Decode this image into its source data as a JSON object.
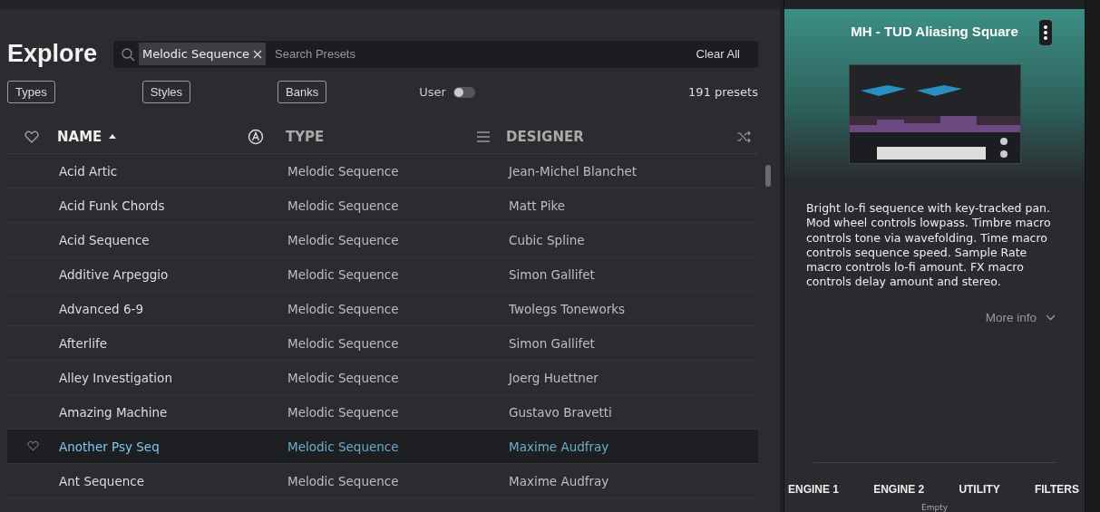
{
  "explore": {
    "title": "Explore",
    "search": {
      "chip": "Melodic Sequence",
      "placeholder": "Search Presets",
      "clear": "Clear All"
    },
    "filters": [
      "Types",
      "Styles",
      "Banks"
    ],
    "user_toggle": {
      "label": "User",
      "on": false
    },
    "count": "191 presets"
  },
  "table": {
    "columns": [
      {
        "kind": "name",
        "label": "NAME",
        "sorted": true
      },
      {
        "kind": "type",
        "label": "TYPE",
        "sorted": false
      },
      {
        "kind": "designer",
        "label": "DESIGNER",
        "sorted": false
      }
    ],
    "rows": [
      {
        "name": "Acid Artic",
        "type": "Melodic Sequence",
        "designer": "Jean-Michel Blanchet",
        "selected": false
      },
      {
        "name": "Acid Funk Chords",
        "type": "Melodic Sequence",
        "designer": "Matt Pike",
        "selected": false
      },
      {
        "name": "Acid Sequence",
        "type": "Melodic Sequence",
        "designer": "Cubic Spline",
        "selected": false
      },
      {
        "name": "Additive Arpeggio",
        "type": "Melodic Sequence",
        "designer": "Simon Gallifet",
        "selected": false
      },
      {
        "name": "Advanced 6-9",
        "type": "Melodic Sequence",
        "designer": "Twolegs Toneworks",
        "selected": false
      },
      {
        "name": "Afterlife",
        "type": "Melodic Sequence",
        "designer": "Simon Gallifet",
        "selected": false
      },
      {
        "name": "Alley Investigation",
        "type": "Melodic Sequence",
        "designer": "Joerg Huettner",
        "selected": false
      },
      {
        "name": "Amazing Machine",
        "type": "Melodic Sequence",
        "designer": "Gustavo Bravetti",
        "selected": false
      },
      {
        "name": "Another Psy Seq",
        "type": "Melodic Sequence",
        "designer": "Maxime Audfray",
        "selected": true
      },
      {
        "name": "Ant Sequence",
        "type": "Melodic Sequence",
        "designer": "Maxime Audfray",
        "selected": false
      }
    ]
  },
  "preset": {
    "title": "MH - TUD Aliasing Square",
    "description": "Bright lo-fi sequence with key-tracked pan. Mod wheel controls lowpass. Timbre macro controls tone via wavefolding. Time macro controls sequence speed. Sample Rate macro controls lo-fi amount. FX macro controls delay amount and stereo.",
    "more_info": "More info",
    "tabs": [
      "ENGINE 1",
      "ENGINE 2",
      "UTILITY",
      "FILTERS"
    ],
    "utility_value": "Empty"
  }
}
